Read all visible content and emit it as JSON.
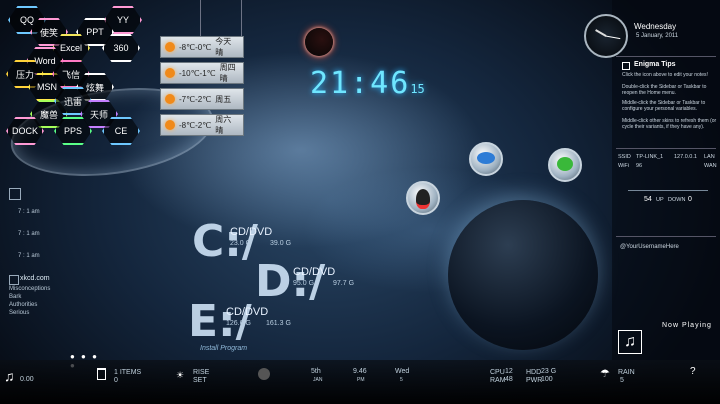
{
  "hex_launcher": [
    {
      "label": "QQ",
      "color": "#6ec8ff"
    },
    {
      "label": "YY",
      "color": "#ff9ad5"
    },
    {
      "label": "使笑",
      "color": "#ff9ad5"
    },
    {
      "label": "PPT",
      "color": "#ffffff"
    },
    {
      "label": "Excel",
      "color": "#f3e65a"
    },
    {
      "label": "360",
      "color": "#ffffff"
    },
    {
      "label": "Word",
      "color": "#ff9ad5"
    },
    {
      "label": "压力",
      "color": "#ffd23a"
    },
    {
      "label": "MSN",
      "color": "#ffe94a"
    },
    {
      "label": "飞信",
      "color": "#ff7bc5"
    },
    {
      "label": "炫舞",
      "color": "#ffffff"
    },
    {
      "label": "魔兽",
      "color": "#a6ff5a"
    },
    {
      "label": "迅雷",
      "color": "#6ec8ff"
    },
    {
      "label": "天师",
      "color": "#c580ff"
    },
    {
      "label": "DOCK",
      "color": "#ff9ad5"
    },
    {
      "label": "PPS",
      "color": "#5aff88"
    },
    {
      "label": "CE",
      "color": "#6ec8ff"
    }
  ],
  "weather": [
    {
      "temp": "-8℃-0℃",
      "desc": "今天晴"
    },
    {
      "temp": "-10℃-1℃",
      "desc": "周四晴"
    },
    {
      "temp": "-7℃-2℃",
      "desc": "周五"
    },
    {
      "temp": "-8℃-2℃",
      "desc": "周六晴"
    }
  ],
  "clock": {
    "time": "21:46",
    "suffix": "15"
  },
  "drives": [
    {
      "letter": "C:/",
      "label": "CD/DVD",
      "free": "23.0 G",
      "total": "39.0 G"
    },
    {
      "letter": "D:/",
      "label": "CD/DVD",
      "free": "95.0 G",
      "total": "97.7 G"
    },
    {
      "letter": "E:/",
      "label": "CD/DVD",
      "free": "126.6 G",
      "total": "161.3 G"
    }
  ],
  "install_program": "Install Program",
  "date_widget": {
    "weekday": "Wednesday",
    "date": "5 January, 2011"
  },
  "enigma_tips": {
    "title": "Enigma Tips",
    "lines": [
      "Click the icon above to edit your notes!",
      "Double-click the Sidebar or Taskbar to reopen the Home menu.",
      "Middle-click the Sidebar or Taskbar to configure your personal variables.",
      "Middle-click other skins to refresh them (or cycle their variants, if they have any)."
    ]
  },
  "network": {
    "ssid_label": "SSID",
    "ssid": "TP-LINK_1",
    "ip": "127.0.0.1",
    "lan": "LAN",
    "wifi_label": "WiFi",
    "wifi": "96",
    "wan": "WAN",
    "up": "54",
    "up_label": "UP",
    "down": "0",
    "down_label": "DOWN"
  },
  "twitter": "@YourUsernameHere",
  "now_playing": "Now Playing",
  "left_panel": {
    "times": [
      "7 : 1 am",
      "7 : 1 am",
      "7 : 1 am"
    ],
    "xkcd": "xkcd.com",
    "xkcd_items": [
      "Misconceptions",
      "Bark",
      "Authorities",
      "Serious"
    ]
  },
  "taskbar": {
    "music_time": "0.00",
    "recycle": "1 ITEMS",
    "recycle_sub": "0",
    "rise": "RISE",
    "set": "SET",
    "day": "5th",
    "month": "JAN",
    "time": "9.46",
    "ampm": "PM",
    "weekday": "Wed",
    "weekday_num": "5",
    "cpu_label": "CPU",
    "cpu": "12",
    "ram_label": "RAM",
    "ram": "48",
    "hdd_label": "HDD",
    "hdd": "23 G",
    "pwr_label": "PWR",
    "pwr": "100",
    "rain": "RAIN",
    "rain_val": "5",
    "question": "?"
  }
}
